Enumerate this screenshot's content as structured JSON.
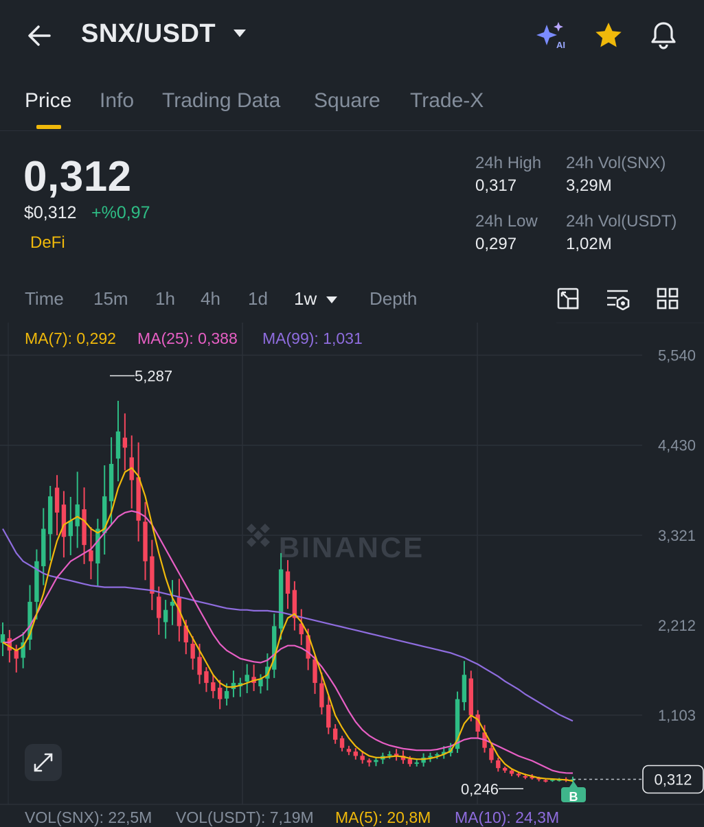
{
  "header": {
    "pair": "SNX/USDT",
    "icons": [
      "back-arrow-icon",
      "dropdown-caret-icon",
      "ai-sparkle-icon",
      "favorite-star-icon",
      "bell-icon"
    ]
  },
  "tabs": [
    "Price",
    "Info",
    "Trading Data",
    "Square",
    "Trade-X"
  ],
  "active_tab": "Price",
  "summary": {
    "last_price": "0,312",
    "fiat_price": "$0,312",
    "change": "+%0,97",
    "tag": "DeFi",
    "high_label": "24h High",
    "high_value": "0,317",
    "vol_base_label": "24h Vol(SNX)",
    "vol_base_value": "3,29M",
    "low_label": "24h Low",
    "low_value": "0,297",
    "vol_quote_label": "24h Vol(USDT)",
    "vol_quote_value": "1,02M"
  },
  "timeframes": [
    "Time",
    "15m",
    "1h",
    "4h",
    "1d",
    "1w",
    "Depth"
  ],
  "active_timeframe": "1w",
  "chart_tools": [
    "chart-settings-icon",
    "indicator-settings-icon",
    "layout-grid-icon",
    "expand-icon"
  ],
  "indicators": {
    "ma7": "MA(7): 0,292",
    "ma25": "MA(25): 0,388",
    "ma99": "MA(99): 1,031"
  },
  "volume": {
    "vol_base": "VOL(SNX): 22,5M",
    "vol_quote": "VOL(USDT): 7,19M",
    "ma5": "MA(5): 20,8M",
    "ma10": "MA(10): 24,3M"
  },
  "watermark": "BINANCE",
  "chart_data": {
    "type": "candlestick",
    "y_ticks": [
      "5,540",
      "4,430",
      "3,321",
      "2,212",
      "1,103"
    ],
    "y_tick_values": [
      5.54,
      4.43,
      3.321,
      2.212,
      1.103
    ],
    "max_label": "5,287",
    "max_value": 5.287,
    "min_label": "0,246",
    "min_value": 0.246,
    "current_label": "0,312",
    "current_value": 0.312,
    "marker_label": "B",
    "closes": [
      2.1,
      1.9,
      1.8,
      2.0,
      2.5,
      3.0,
      3.4,
      3.8,
      3.6,
      3.3,
      3.5,
      3.7,
      3.2,
      3.0,
      3.4,
      3.8,
      4.2,
      4.6,
      4.4,
      4.0,
      3.5,
      3.0,
      2.6,
      2.3,
      2.4,
      2.5,
      2.2,
      2.0,
      1.8,
      1.6,
      1.5,
      1.4,
      1.3,
      1.4,
      1.5,
      1.5,
      1.6,
      1.5,
      1.55,
      1.7,
      2.2,
      2.9,
      2.6,
      2.3,
      2.1,
      1.8,
      1.5,
      1.2,
      0.95,
      0.8,
      0.7,
      0.65,
      0.6,
      0.55,
      0.52,
      0.55,
      0.6,
      0.62,
      0.6,
      0.55,
      0.5,
      0.52,
      0.58,
      0.6,
      0.62,
      0.65,
      0.7,
      1.3,
      1.6,
      1.1,
      0.9,
      0.7,
      0.55,
      0.45,
      0.42,
      0.38,
      0.36,
      0.34,
      0.33,
      0.31,
      0.3,
      0.31,
      0.31,
      0.3,
      0.312
    ],
    "ma7": [
      2.0,
      1.95,
      1.9,
      1.95,
      2.1,
      2.35,
      2.6,
      2.95,
      3.25,
      3.45,
      3.5,
      3.55,
      3.5,
      3.4,
      3.35,
      3.4,
      3.6,
      3.9,
      4.1,
      4.15,
      4.05,
      3.8,
      3.45,
      3.1,
      2.8,
      2.55,
      2.4,
      2.2,
      2.05,
      1.9,
      1.75,
      1.6,
      1.5,
      1.45,
      1.45,
      1.47,
      1.5,
      1.53,
      1.55,
      1.6,
      1.8,
      2.1,
      2.3,
      2.35,
      2.25,
      2.1,
      1.85,
      1.6,
      1.35,
      1.1,
      0.95,
      0.82,
      0.72,
      0.65,
      0.6,
      0.58,
      0.58,
      0.59,
      0.6,
      0.59,
      0.57,
      0.56,
      0.56,
      0.57,
      0.59,
      0.62,
      0.66,
      0.8,
      1.0,
      1.1,
      1.05,
      0.9,
      0.75,
      0.6,
      0.5,
      0.44,
      0.4,
      0.37,
      0.35,
      0.33,
      0.32,
      0.315,
      0.31,
      0.305,
      0.292
    ],
    "ma25": [
      2.0,
      2.0,
      2.05,
      2.1,
      2.2,
      2.35,
      2.5,
      2.65,
      2.8,
      2.9,
      3.0,
      3.05,
      3.1,
      3.15,
      3.25,
      3.35,
      3.45,
      3.55,
      3.6,
      3.62,
      3.6,
      3.55,
      3.45,
      3.3,
      3.15,
      3.0,
      2.85,
      2.7,
      2.55,
      2.4,
      2.25,
      2.1,
      1.98,
      1.9,
      1.85,
      1.8,
      1.78,
      1.76,
      1.75,
      1.78,
      1.85,
      1.92,
      1.96,
      1.96,
      1.93,
      1.88,
      1.8,
      1.7,
      1.58,
      1.45,
      1.3,
      1.15,
      1.02,
      0.92,
      0.85,
      0.8,
      0.76,
      0.73,
      0.71,
      0.69,
      0.68,
      0.67,
      0.67,
      0.67,
      0.68,
      0.7,
      0.72,
      0.76,
      0.8,
      0.82,
      0.82,
      0.8,
      0.76,
      0.72,
      0.68,
      0.64,
      0.6,
      0.57,
      0.54,
      0.5,
      0.46,
      0.42,
      0.4,
      0.39,
      0.388
    ],
    "ma99": [
      3.4,
      3.25,
      3.1,
      3.0,
      2.95,
      2.9,
      2.85,
      2.82,
      2.8,
      2.78,
      2.76,
      2.74,
      2.72,
      2.7,
      2.69,
      2.68,
      2.68,
      2.68,
      2.68,
      2.67,
      2.66,
      2.65,
      2.64,
      2.62,
      2.6,
      2.58,
      2.56,
      2.54,
      2.52,
      2.5,
      2.48,
      2.46,
      2.44,
      2.42,
      2.41,
      2.4,
      2.4,
      2.39,
      2.39,
      2.39,
      2.38,
      2.37,
      2.35,
      2.33,
      2.31,
      2.29,
      2.27,
      2.25,
      2.23,
      2.21,
      2.19,
      2.17,
      2.15,
      2.13,
      2.11,
      2.09,
      2.07,
      2.05,
      2.03,
      2.01,
      1.99,
      1.97,
      1.95,
      1.93,
      1.91,
      1.89,
      1.87,
      1.84,
      1.81,
      1.77,
      1.73,
      1.68,
      1.63,
      1.58,
      1.52,
      1.47,
      1.42,
      1.36,
      1.31,
      1.26,
      1.21,
      1.16,
      1.11,
      1.07,
      1.031
    ]
  },
  "colors": {
    "background": "#1e2329",
    "up": "#2ebd85",
    "down": "#f6465d",
    "ma7": "#f0b90b",
    "ma25": "#e85fc5",
    "ma99": "#8f6ddf",
    "accent": "#f0b90b",
    "muted": "#848e9c"
  }
}
